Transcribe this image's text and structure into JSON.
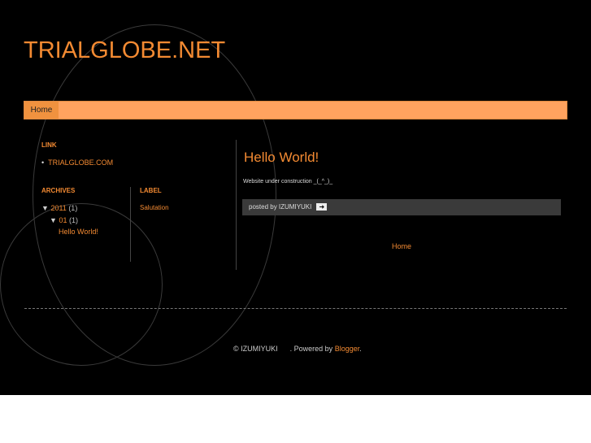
{
  "site_title": "TRIALGLOBE.NET",
  "nav": {
    "home": "Home"
  },
  "sidebar": {
    "link_heading": "LINK",
    "links": [
      "TRIALGLOBE.COM"
    ],
    "archives_heading": "ARCHIVES",
    "archive_year": "2011",
    "archive_year_count": "(1)",
    "archive_month": "01",
    "archive_month_count": "(1)",
    "archive_post": "Hello World!",
    "label_heading": "LABEL",
    "labels": [
      "Salutation"
    ]
  },
  "post": {
    "title": "Hello World!",
    "body": "Website under construction _(_^_)_",
    "posted_by": "posted by IZUMIYUKI"
  },
  "home_link": "Home",
  "footer": {
    "copyright": "© IZUMIYUKI",
    "powered": ". Powered by ",
    "blogger": "Blogger",
    "end": "."
  }
}
